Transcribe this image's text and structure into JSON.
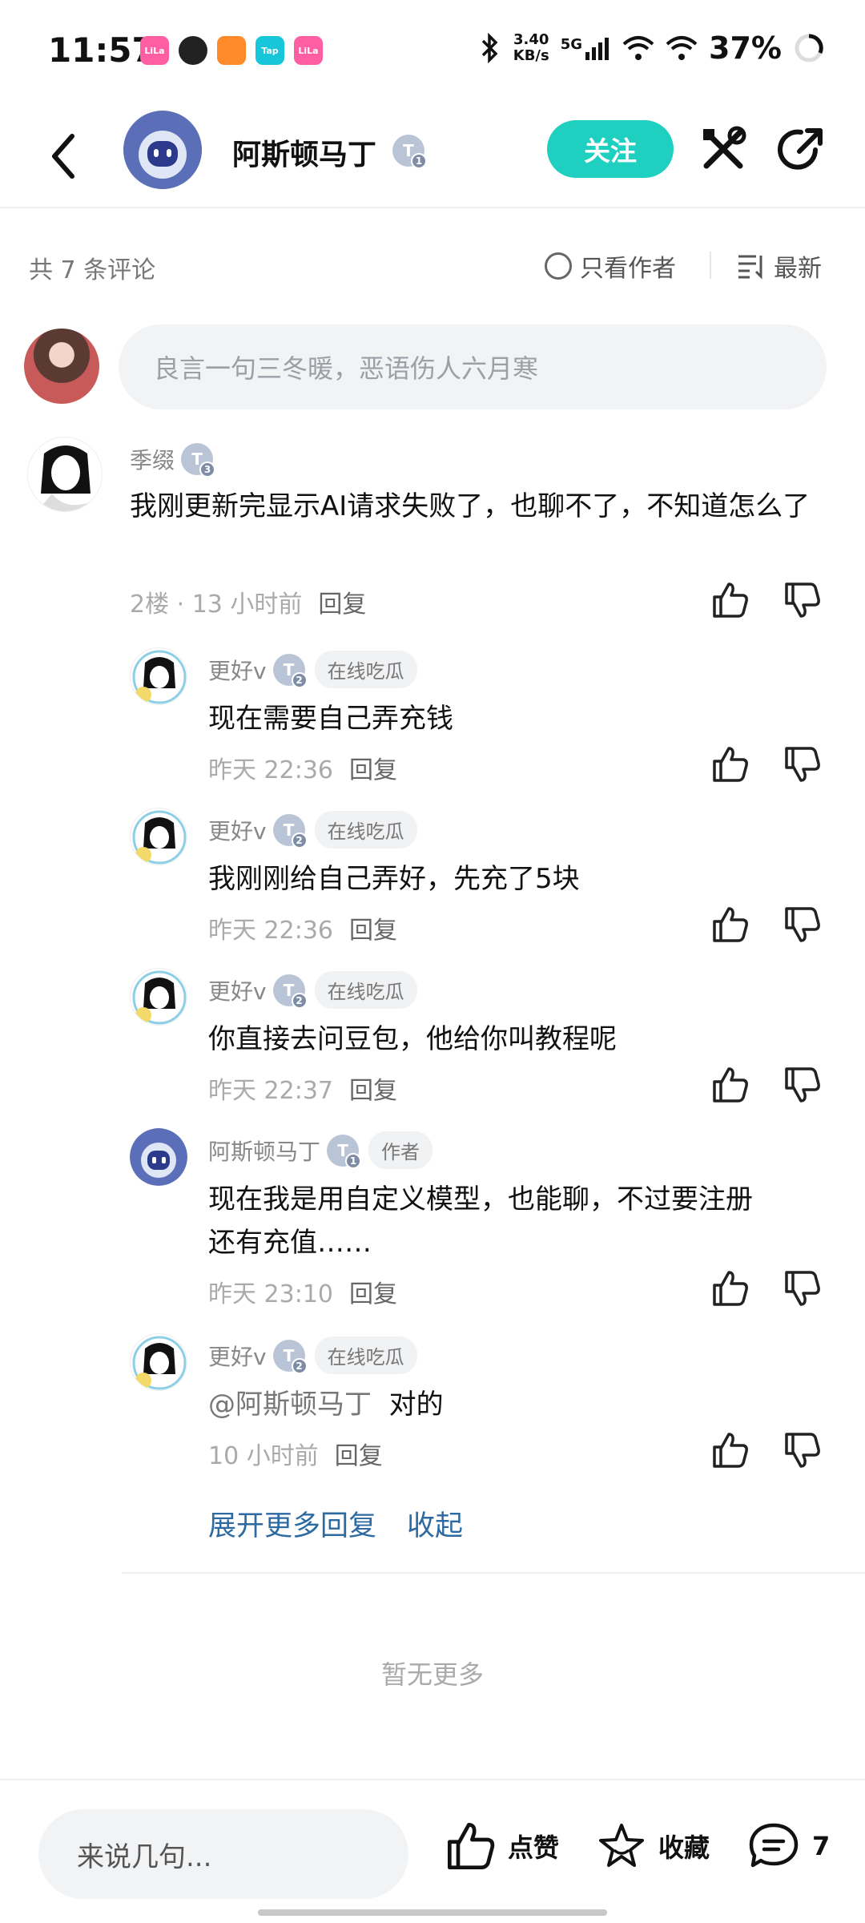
{
  "status_bar": {
    "time": "11:57",
    "apps": [
      "LiLa",
      "",
      "",
      "Tap",
      "LiLa"
    ],
    "net_speed_top": "3.40",
    "net_speed_bottom": "KB/s",
    "net_type": "5G",
    "battery": "37%"
  },
  "header": {
    "author_name": "阿斯顿马丁",
    "author_level": "1",
    "follow_label": "关注"
  },
  "toolbar": {
    "count_label": "共 7 条评论",
    "author_only_label": "只看作者",
    "sort_label": "最新"
  },
  "compose": {
    "placeholder": "良言一句三冬暖，恶语伤人六月寒"
  },
  "comments": [
    {
      "name": "季缀",
      "level": "3",
      "text": "我刚更新完显示AI请求失败了，也聊不了，不知道怎么了",
      "floor": "2楼 · 13 小时前",
      "reply": "回复"
    },
    {
      "name": "更好v",
      "level": "2",
      "tag": "在线吃瓜",
      "text": "现在需要自己弄充钱",
      "time": "昨天 22:36",
      "reply": "回复"
    },
    {
      "name": "更好v",
      "level": "2",
      "tag": "在线吃瓜",
      "text": "我刚刚给自己弄好，先充了5块",
      "time": "昨天 22:36",
      "reply": "回复"
    },
    {
      "name": "更好v",
      "level": "2",
      "tag": "在线吃瓜",
      "text": "你直接去问豆包，他给你叫教程呢",
      "time": "昨天 22:37",
      "reply": "回复"
    },
    {
      "name": "阿斯顿马丁",
      "level": "1",
      "tag": "作者",
      "text_line1": "现在我是用自定义模型，也能聊，不过要注册",
      "text_line2": "还有充值……",
      "time": "昨天 23:10",
      "reply": "回复"
    },
    {
      "name": "更好v",
      "level": "2",
      "tag": "在线吃瓜",
      "mention": "@阿斯顿马丁",
      "text": "对的",
      "time": "10 小时前",
      "reply": "回复"
    }
  ],
  "expand_more_label": "展开更多回复",
  "collapse_label": "收起",
  "no_more_label": "暂无更多",
  "bottom_bar": {
    "input_placeholder": "来说几句...",
    "like_label": "点赞",
    "favorite_label": "收藏",
    "comment_count": "7"
  },
  "colors": {
    "accent": "#1fd0c1",
    "link": "#2c6aa1"
  }
}
